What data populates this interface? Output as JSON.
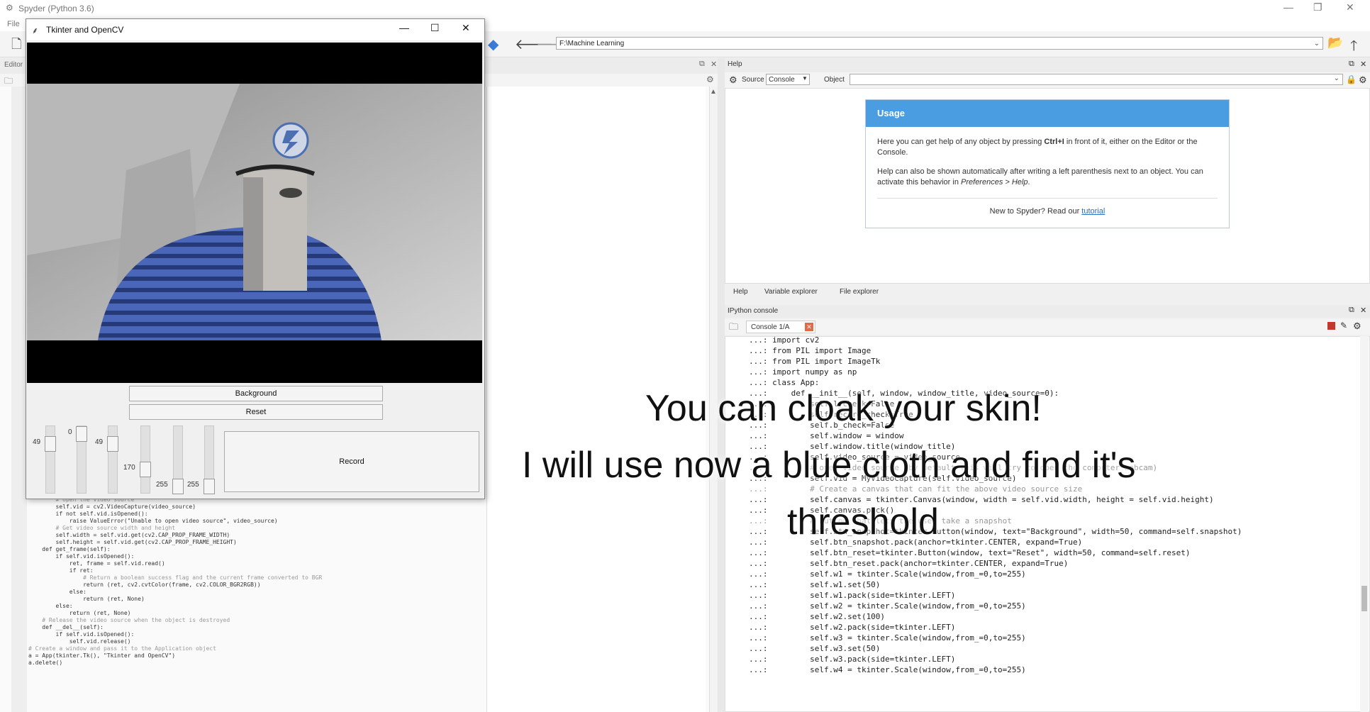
{
  "app": {
    "title": "Spyder (Python 3.6)",
    "menu_file": "File"
  },
  "toolbar": {
    "path": "F:\\Machine Learning"
  },
  "editor": {
    "label": "Editor"
  },
  "help": {
    "header": "Help",
    "source_label": "Source",
    "source_value": "Console",
    "object_label": "Object",
    "usage_title": "Usage",
    "usage_p1a": "Here you can get help of any object by pressing ",
    "usage_p1b": "Ctrl+I",
    "usage_p1c": " in front of it, either on the Editor or the Console.",
    "usage_p2a": "Help can also be shown automatically after writing a left parenthesis next to an object. You can activate this behavior in ",
    "usage_p2b": "Preferences > Help",
    "usage_p2c": ".",
    "new_text": "New to Spyder? Read our ",
    "tutorial": "tutorial",
    "tabs": [
      "Help",
      "Variable explorer",
      "File explorer"
    ]
  },
  "ipython": {
    "header": "IPython console",
    "tab": "Console 1/A"
  },
  "console_lines": [
    "...: import cv2",
    "...: from PIL import Image",
    "...: from PIL import ImageTk",
    "...: import numpy as np",
    "...: class App:",
    "...:     def __init__(self, window, window_title, video_source=0):",
    "...:         self.l_check=False",
    "...:         self.record_check=True",
    "...:         self.b_check=False",
    "...:         self.window = window",
    "...:         self.window.title(window_title)",
    "...:         self.video_source = video_source",
    "...:         # open video source (by default this will try to open the computer webcam)",
    "...:         self.vid = MyVideoCapture(self.video_source)",
    "...:         # Create a canvas that can fit the above video source size",
    "...:         self.canvas = tkinter.Canvas(window, width = self.vid.width, height = self.vid.height)",
    "...:         self.canvas.pack()",
    "...:         # Button that lets the user take a snapshot",
    "...:         self.btn_snapshot=tkinter.Button(window, text=\"Background\", width=50, command=self.snapshot)",
    "...:         self.btn_snapshot.pack(anchor=tkinter.CENTER, expand=True)",
    "...:         self.btn_reset=tkinter.Button(window, text=\"Reset\", width=50, command=self.reset)",
    "...:         self.btn_reset.pack(anchor=tkinter.CENTER, expand=True)",
    "...:         self.w1 = tkinter.Scale(window,from_=0,to=255)",
    "...:         self.w1.set(50)",
    "...:         self.w1.pack(side=tkinter.LEFT)",
    "...:         self.w2 = tkinter.Scale(window,from_=0,to=255)",
    "...:         self.w2.set(100)",
    "...:         self.w2.pack(side=tkinter.LEFT)",
    "...:         self.w3 = tkinter.Scale(window,from_=0,to=255)",
    "...:         self.w3.set(50)",
    "...:         self.w3.pack(side=tkinter.LEFT)",
    "...:         self.w4 = tkinter.Scale(window,from_=0,to=255)"
  ],
  "editor_lines": [
    "        # open the video source",
    "        self.vid = cv2.VideoCapture(video_source)",
    "        if not self.vid.isOpened():",
    "            raise ValueError(\"Unable to open video source\", video_source)",
    "",
    "        # Get video source width and height",
    "        self.width = self.vid.get(cv2.CAP_PROP_FRAME_WIDTH)",
    "        self.height = self.vid.get(cv2.CAP_PROP_FRAME_HEIGHT)",
    "",
    "    def get_frame(self):",
    "        if self.vid.isOpened():",
    "            ret, frame = self.vid.read()",
    "            if ret:",
    "                # Return a boolean success flag and the current frame converted to BGR",
    "                return (ret, cv2.cvtColor(frame, cv2.COLOR_BGR2RGB))",
    "            else:",
    "                return (ret, None)",
    "        else:",
    "            return (ret, None)",
    "",
    "    # Release the video source when the object is destroyed",
    "    def __del__(self):",
    "        if self.vid.isOpened():",
    "            self.vid.release()",
    "",
    "",
    "# Create a window and pass it to the Application object",
    "",
    "a = App(tkinter.Tk(), \"Tkinter and OpenCV\")",
    "a.delete()"
  ],
  "tk": {
    "title": "Tkinter and OpenCV",
    "background_btn": "Background",
    "reset_btn": "Reset",
    "record_btn": "Record",
    "sliders": [
      {
        "value": "49",
        "level": 0.19
      },
      {
        "value": "0",
        "level": 0.0
      },
      {
        "value": "49",
        "level": 0.19
      },
      {
        "value": "170",
        "level": 0.67
      },
      {
        "value": "255",
        "level": 1.0
      },
      {
        "value": "255",
        "level": 1.0
      }
    ]
  },
  "subtitle": {
    "line1": "You can cloak your skin!",
    "line2": "I will use now a blue cloth and find it's",
    "line3": "threshold"
  }
}
